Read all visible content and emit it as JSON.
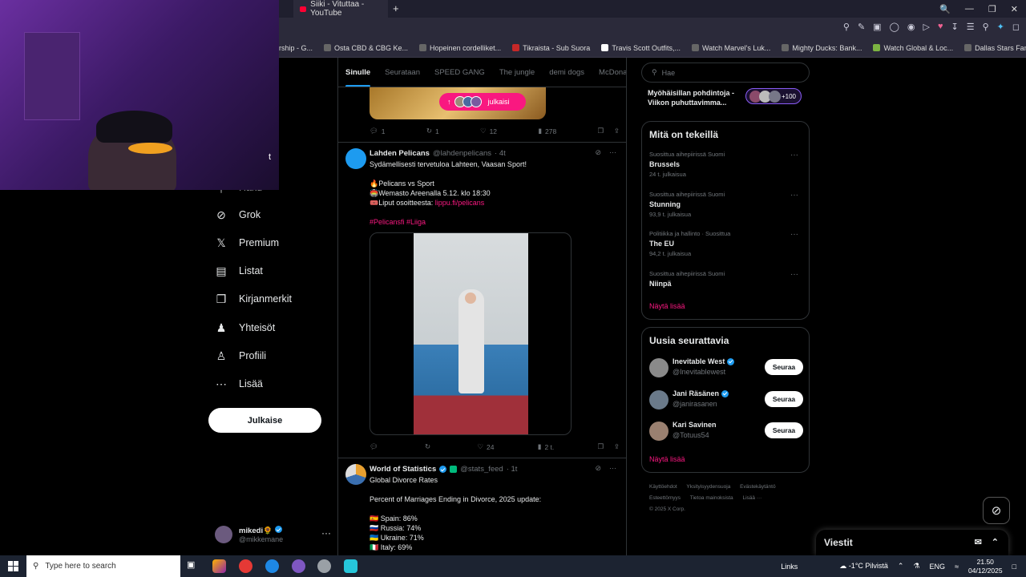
{
  "browser": {
    "tab_title": "Siiki - Vituttaa - YouTube",
    "new_tab": "+",
    "bookmarks": [
      "rship - G...",
      "Osta CBD & CBG Ke...",
      "Hopeinen cordelliket...",
      "Tikraista - Sub Suora",
      "Travis Scott Outfits,...",
      "Watch Marvel's Luk...",
      "Mighty Ducks: Bank...",
      "Watch Global & Loc...",
      "Dallas Stars Fanatics..."
    ]
  },
  "left_nav": {
    "partial_item": "Haku",
    "items": [
      {
        "label": "Grok",
        "icon": "grok-icon"
      },
      {
        "label": "Premium",
        "icon": "x-logo-icon"
      },
      {
        "label": "Listat",
        "icon": "list-icon"
      },
      {
        "label": "Kirjanmerkit",
        "icon": "bookmark-icon"
      },
      {
        "label": "Yhteisöt",
        "icon": "communities-icon"
      },
      {
        "label": "Profiili",
        "icon": "profile-icon"
      },
      {
        "label": "Lisää",
        "icon": "more-circle-icon"
      }
    ],
    "post_button": "Julkaise",
    "account": {
      "name": "mikedi",
      "emoji": "🌻",
      "handle": "@mikkemane",
      "more": "···"
    },
    "webcam_partial_text": "t"
  },
  "feed": {
    "tabs": [
      "Sinulle",
      "Seurataan",
      "SPEED GANG",
      "The jungle",
      "demi dogs",
      "McDonal"
    ],
    "active_tab": "Sinulle",
    "new_posts_pill": "julkaisi",
    "tweet0_actions": {
      "replies": "1",
      "retweets": "1",
      "likes": "12",
      "views": "278"
    },
    "tweet1": {
      "name": "Lahden Pelicans",
      "handle": "@lahdenpelicans",
      "time": "· 4t",
      "lines": [
        "Sydämellisesti tervetuloa Lahteen, Vaasan Sport!",
        "",
        "🔥Pelicans vs Sport",
        "🏟️Wemasto Areenalla 5.12. klo 18:30",
        "🎟️Liput osoitteesta: "
      ],
      "link": "lippu.fi/pelicans",
      "hashtags": "#Pelicansfi #Liiga",
      "actions": {
        "replies": "",
        "retweets": "",
        "likes": "24",
        "views": "2 t."
      }
    },
    "tweet2": {
      "name": "World of Statistics",
      "handle": "@stats_feed",
      "time": "· 1t",
      "title": "Global Divorce Rates",
      "subtitle": "Percent of Marriages Ending in Divorce, 2025 update:",
      "rows": [
        "🇪🇸 Spain: 86%",
        "🇷🇺 Russia: 74%",
        "🇺🇦 Ukraine: 71%",
        "🇮🇹 Italy: 69%"
      ]
    }
  },
  "right": {
    "search_placeholder": "Hae",
    "space": {
      "title": "Myöhäisillan pohdintoja - Viikon puhuttavimma...",
      "count": "+100"
    },
    "trending": {
      "title": "Mitä on tekeillä",
      "items": [
        {
          "context": "Suosittua aihepiirissä Suomi",
          "topic": "Brussels",
          "count": "24 t. julkaisua"
        },
        {
          "context": "Suosittua aihepiirissä Suomi",
          "topic": "Stunning",
          "count": "93,9 t. julkaisua"
        },
        {
          "context": "Politiikka ja hallinto · Suosittua",
          "topic": "The EU",
          "count": "94,2 t. julkaisua"
        },
        {
          "context": "Suosittua aihepiirissä Suomi",
          "topic": "Niinpä",
          "count": ""
        }
      ],
      "show_more": "Näytä lisää"
    },
    "who_to_follow": {
      "title": "Uusia seurattavia",
      "users": [
        {
          "name": "Inevitable West",
          "handle": "@Inevitablewest",
          "button": "Seuraa"
        },
        {
          "name": "Jani Räsänen",
          "handle": "@janirasanen",
          "button": "Seuraa"
        },
        {
          "name": "Kari Savinen",
          "handle": "@Totuus54",
          "button": "Seuraa"
        }
      ],
      "show_more": "Näytä lisää"
    },
    "footer": [
      "Käyttöehdot",
      "Yksityisyydensuoja",
      "Evästekäytäntö",
      "Esteettömyys",
      "Tietoa mainoksista",
      "Lisää ···",
      "© 2025 X Corp."
    ],
    "messages": "Viestit"
  },
  "taskbar": {
    "search_placeholder": "Type here to search",
    "links": "Links",
    "weather": "-1°C  Pilvistä",
    "lang": "ENG",
    "time": "21.50",
    "date": "04/12/2025"
  }
}
